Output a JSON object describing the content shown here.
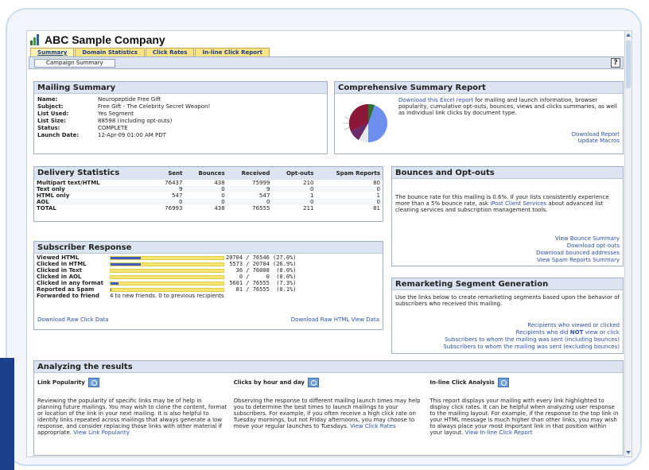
{
  "app": {
    "title": "ABC Sample Company"
  },
  "tabs": [
    {
      "label": "Summary"
    },
    {
      "label": "Domain Statistics"
    },
    {
      "label": "Click Rates"
    },
    {
      "label": "In-line Click Report"
    }
  ],
  "subnav": {
    "button": "Campaign Summary",
    "help": "?"
  },
  "mailing_summary": {
    "title": "Mailing Summary",
    "rows": [
      {
        "key": "Name:",
        "value": "Neuropeptide Free Gift"
      },
      {
        "key": "Subject:",
        "value": "Free Gift - The Celebrity Secret Weapon!"
      },
      {
        "key": "List Used:",
        "value": "Yes Segment"
      },
      {
        "key": "List Size:",
        "value": "88598 (including opt-outs)"
      },
      {
        "key": "Status:",
        "value": "COMPLETE"
      },
      {
        "key": "Launch Date:",
        "value": "12-Apr-09 01:00 AM PDT"
      }
    ]
  },
  "comprehensive": {
    "title": "Comprehensive Summary Report",
    "link": "Download this Excel report",
    "text": " for mailing and launch information, browser popularity, cumulative opt-outs, bounces, views and clicks summaries, as well as individual link clicks by document type.",
    "download": "Download Report",
    "update": "Update Macros"
  },
  "delivery": {
    "title": "Delivery Statistics",
    "headers": [
      "Sent",
      "Bounces",
      "Received",
      "Opt-outs",
      "Spam Reports"
    ],
    "rows": [
      {
        "label": "Multipart text/HTML",
        "values": [
          "76437",
          "438",
          "75999",
          "210",
          "80"
        ]
      },
      {
        "label": "Text only",
        "values": [
          "9",
          "0",
          "9",
          "0",
          "0"
        ]
      },
      {
        "label": "HTML only",
        "values": [
          "547",
          "0",
          "547",
          "1",
          "1"
        ]
      },
      {
        "label": "AOL",
        "values": [
          "0",
          "0",
          "0",
          "0",
          "0"
        ]
      },
      {
        "label": "TOTAL",
        "values": [
          "76993",
          "438",
          "76555",
          "211",
          "81"
        ]
      }
    ]
  },
  "bounces": {
    "title": "Bounces and Opt-outs",
    "text_before": "The bounce rate for this mailing is 0.6%. If your lists consistently experience more than a 5% bounce rate, ask ",
    "link": "iPost Client Services",
    "text_after": " about advanced list cleaning services and subscription management tools.",
    "links": [
      "View Bounce Summary",
      "Download opt-outs",
      "Download bounced addresses",
      "View Spam Reports Summary"
    ]
  },
  "subscriber": {
    "title": "Subscriber Response",
    "rows": [
      {
        "label": "Viewed HTML",
        "fraction": 0.27,
        "value": "20704 / 76546 (27.0%)"
      },
      {
        "label": "Clicked in HTML",
        "fraction": 0.269,
        "value": " 5573 / 20704 (26.9%)"
      },
      {
        "label": "Clicked in Text",
        "fraction": 0.0,
        "value": "   36 / 76008  (0.0%)"
      },
      {
        "label": "Clicked in AOL",
        "fraction": 0.0,
        "value": "    0 /     0  (0.0%)"
      },
      {
        "label": "Clicked in any format",
        "fraction": 0.073,
        "value": " 5601 / 76555  (7.3%)"
      },
      {
        "label": "Reported as Spam",
        "fraction": 0.001,
        "value": "   81 / 76555  (0.1%)"
      }
    ],
    "forward_label": "Forwarded to friend",
    "forward_value": "4 to new friends. 0 to previous recipients",
    "download_click": "Download Raw Click Data",
    "download_html": "Download Raw HTML View Data"
  },
  "remarketing": {
    "title": "Remarketing Segment Generation",
    "text": "Use the links below to create remarketing segments based upon the behavior of subscribers who received this mailing.",
    "links": [
      "Recipients who viewed or clicked",
      "Subscribers to whom the mailing was sent (including bounces)",
      "Subscribers to whom the mailing was sent (excluding bounces)"
    ],
    "not_prefix": "Recipients who did ",
    "not_word": "NOT",
    "not_suffix": " view or click"
  },
  "analyzing": {
    "title": "Analyzing the results",
    "columns": [
      {
        "heading": "Link Popularity",
        "text": "Reviewing the popularity of specific links may be of help in planning future mailings. You may wish to clone the content, format or location of the link in your next mailing. It is also helpful to identify links repeated across mailings that always generate a low response, and consider replacing those links with other material if appropriate. ",
        "link": "View Link Popularity"
      },
      {
        "heading": "Clicks by hour and day",
        "text": "Observing the response to different mailing launch times may help you to determine the best times to launch mailings to your subscribers. For example, if you often receive a high click rate on Tuesday mornings, but not Friday afternoons, you may choose to move your regular launches to Tuesdays. ",
        "link": "View Click Rates"
      },
      {
        "heading": "In-line Click Analysis",
        "text": "This report displays your mailing with every link highlighted to display click rates. It can be helpful when analyzing user response to the mailing layout. For example, if the response to the top link in your HTML message is much higher than other links, you may wish to always place your most important link in that position within your layout. ",
        "link": "View In-line Click Report"
      }
    ]
  },
  "colors": {
    "accent": "#1c3f8c",
    "tab": "#fbe388",
    "bar_fill": "#3a5ec6",
    "bar_track": "#f8e46a",
    "pie": [
      "#6c8ff0",
      "#8b1838",
      "#e8e8e8",
      "#6a2a6a",
      "#2f6f2f"
    ]
  }
}
